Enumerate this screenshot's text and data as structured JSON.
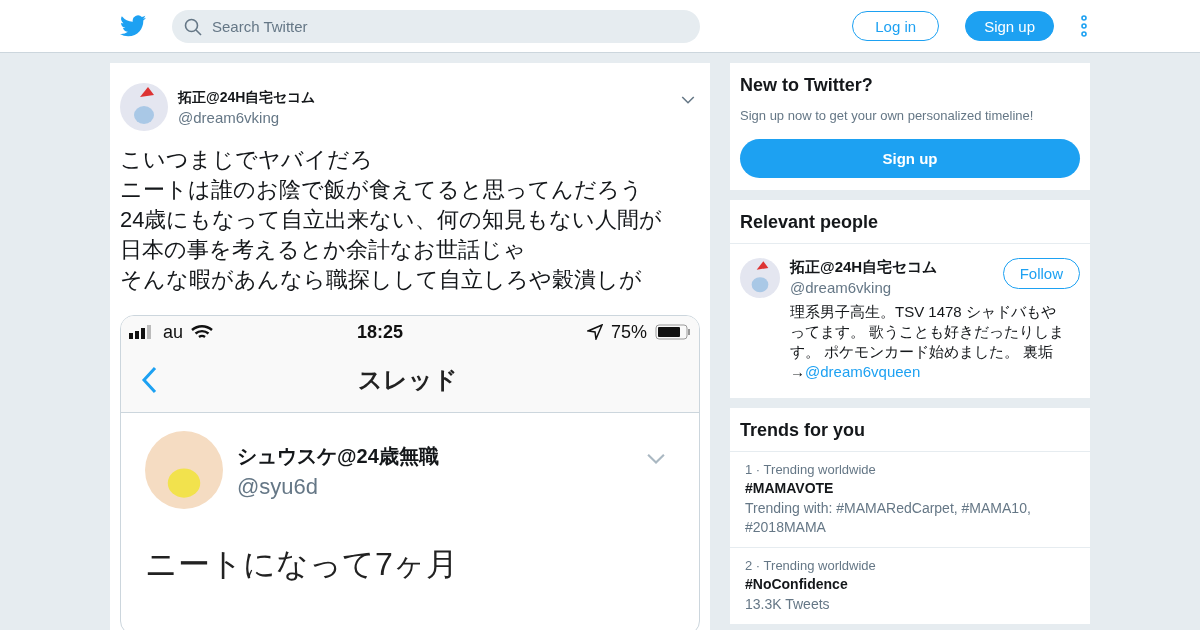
{
  "header": {
    "search": {
      "placeholder": "Search Twitter"
    },
    "login": "Log in",
    "signup": "Sign up"
  },
  "tweet": {
    "name": "拓正@24H自宅セコム",
    "handle": "@dream6vking",
    "text_lines": [
      "こいつまじでヤバイだろ",
      "ニートは誰のお陰で飯が食えてると思ってんだろう",
      "24歳にもなって自立出来ない、何の知見もない人間が",
      "日本の事を考えるとか余計なお世話じゃ",
      "そんな暇があんなら職探しして自立しろや穀潰しが"
    ],
    "screenshot": {
      "carrier": "au",
      "time": "18:25",
      "battery": "75%",
      "title": "スレッド",
      "name": "シュウスケ@24歳無職",
      "handle": "@syu6d",
      "text": "ニートになって7ヶ月"
    }
  },
  "new_to_twitter": {
    "title": "New to Twitter?",
    "subtitle": "Sign up now to get your own personalized timeline!",
    "button": "Sign up"
  },
  "relevant_people": {
    "title": "Relevant people",
    "people": [
      {
        "name": "拓正@24H自宅セコム",
        "handle": "@dream6vking",
        "follow": "Follow",
        "bio": "理系男子高生。TSV 1478 シャドバもやってます。 歌うことも好きだったりします。 ポケモンカード始めました。 裏垢→",
        "bio_link": "@dream6vqueen"
      }
    ]
  },
  "trends": {
    "title": "Trends for you",
    "items": [
      {
        "rank": "1",
        "separator": "·",
        "context": "Trending worldwide",
        "name": "#MAMAVOTE",
        "meta": "Trending with: #MAMARedCarpet, #MAMA10, #2018MAMA"
      },
      {
        "rank": "2",
        "separator": "·",
        "context": "Trending worldwide",
        "name": "#NoConfidence",
        "meta": "13.3K Tweets"
      }
    ]
  }
}
